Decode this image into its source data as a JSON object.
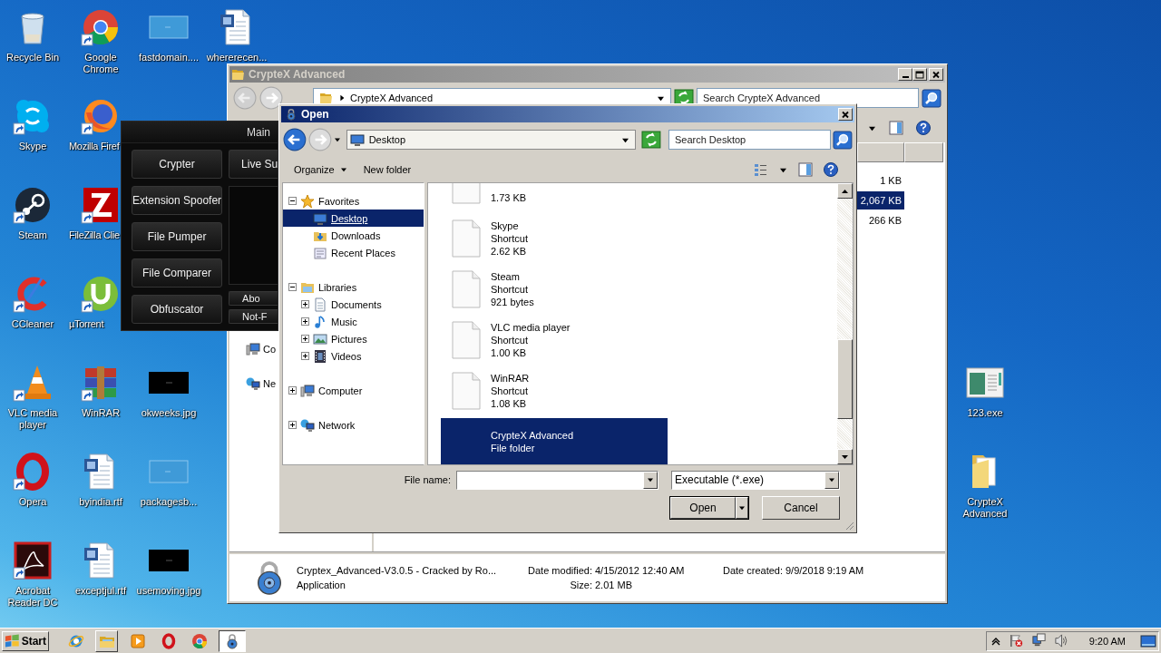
{
  "desktop_icons": [
    {
      "label": "Recycle Bin",
      "kind": "recycle",
      "shortcut": false
    },
    {
      "label": "Google Chrome",
      "kind": "chrome",
      "shortcut": true
    },
    {
      "label": "fastdomain....",
      "kind": "image-light",
      "shortcut": false
    },
    {
      "label": "whererecen...",
      "kind": "word",
      "shortcut": false
    },
    {
      "label": "Skype",
      "kind": "skype",
      "shortcut": true
    },
    {
      "label": "Mozilla Firef",
      "kind": "firefox",
      "shortcut": true
    },
    {
      "label": "Steam",
      "kind": "steam",
      "shortcut": true
    },
    {
      "label": "FileZilla Clie",
      "kind": "filezilla",
      "shortcut": true
    },
    {
      "label": "CCleaner",
      "kind": "ccleaner",
      "shortcut": true
    },
    {
      "label": "µTorrent",
      "kind": "utorrent",
      "shortcut": true
    },
    {
      "label": "VLC media player",
      "kind": "vlc",
      "shortcut": true
    },
    {
      "label": "WinRAR",
      "kind": "winrar",
      "shortcut": true
    },
    {
      "label": "okweeks.jpg",
      "kind": "image-dark",
      "shortcut": false
    },
    {
      "label": "Opera",
      "kind": "opera",
      "shortcut": true
    },
    {
      "label": "byindia.rtf",
      "kind": "word",
      "shortcut": false
    },
    {
      "label": "packagesb...",
      "kind": "image-light",
      "shortcut": false
    },
    {
      "label": "Acrobat Reader DC",
      "kind": "acrobat",
      "shortcut": true
    },
    {
      "label": "exceptjul.rtf",
      "kind": "word",
      "shortcut": false
    },
    {
      "label": "usemoving.jpg",
      "kind": "image-dark",
      "shortcut": false
    },
    {
      "label": "123.exe",
      "kind": "app-window",
      "shortcut": false
    },
    {
      "label": "CrypteX Advanced",
      "kind": "folder",
      "shortcut": false
    }
  ],
  "explorer": {
    "title": "CrypteX Advanced",
    "address": "CrypteX Advanced",
    "search_placeholder": "Search CrypteX Advanced",
    "nav_items": [
      {
        "label": "Co",
        "kind": "computer"
      },
      {
        "label": "Ne",
        "kind": "network"
      }
    ],
    "rows": [
      {
        "size": "1 KB",
        "selected": false
      },
      {
        "size": "2,067 KB",
        "selected": true
      },
      {
        "size": "266 KB",
        "selected": false
      }
    ],
    "details": {
      "name": "Cryptex_Advanced-V3.0.5 - Cracked by Ro...",
      "type": "Application",
      "modified_label": "Date modified:",
      "modified": "4/15/2012 12:40 AM",
      "size_label": "Size:",
      "size": "2.01 MB",
      "created_label": "Date created:",
      "created": "9/9/2018 9:19 AM"
    }
  },
  "crypter": {
    "tab": "Main",
    "left_buttons": [
      "Crypter",
      "Extension Spoofer",
      "File Pumper",
      "File Comparer",
      "Obfuscator"
    ],
    "right_buttons": [
      {
        "label": "Live Su",
        "kind": "large"
      },
      {
        "label": "Abo",
        "kind": "small"
      },
      {
        "label": "Not-F",
        "kind": "small"
      }
    ]
  },
  "open_dialog": {
    "title": "Open",
    "address": "Desktop",
    "search_placeholder": "Search Desktop",
    "toolbar": [
      {
        "label": "Organize",
        "kind": "menu"
      },
      {
        "label": "New folder",
        "kind": "button"
      }
    ],
    "nav": [
      {
        "label": "Favorites",
        "kind": "favorites",
        "expanded": true,
        "selected": false,
        "children": [
          {
            "label": "Desktop",
            "kind": "desktop",
            "selected": true
          },
          {
            "label": "Downloads",
            "kind": "downloads",
            "selected": false
          },
          {
            "label": "Recent Places",
            "kind": "recent",
            "selected": false
          }
        ]
      },
      {
        "label": "Libraries",
        "kind": "libraries",
        "expanded": true,
        "selected": false,
        "children": [
          {
            "label": "Documents",
            "kind": "documents",
            "expanded": false,
            "selected": false
          },
          {
            "label": "Music",
            "kind": "music",
            "expanded": false,
            "selected": false
          },
          {
            "label": "Pictures",
            "kind": "pictures",
            "expanded": false,
            "selected": false
          },
          {
            "label": "Videos",
            "kind": "videos",
            "expanded": false,
            "selected": false
          }
        ]
      },
      {
        "label": "Computer",
        "kind": "computer",
        "expanded": false,
        "selected": false
      },
      {
        "label": "Network",
        "kind": "network",
        "expanded": false,
        "selected": false
      }
    ],
    "files": [
      {
        "size": "1.73 KB",
        "kind": "shortcut",
        "selected": false
      },
      {
        "name": "Skype",
        "type": "Shortcut",
        "size": "2.62 KB",
        "kind": "shortcut",
        "selected": false
      },
      {
        "name": "Steam",
        "type": "Shortcut",
        "size": "921 bytes",
        "kind": "shortcut",
        "selected": false
      },
      {
        "name": "VLC media player",
        "type": "Shortcut",
        "size": "1.00 KB",
        "kind": "shortcut",
        "selected": false
      },
      {
        "name": "WinRAR",
        "type": "Shortcut",
        "size": "1.08 KB",
        "kind": "shortcut",
        "selected": false
      },
      {
        "name": "CrypteX Advanced",
        "type": "File folder",
        "kind": "folder",
        "selected": true
      }
    ],
    "file_name_label": "File name:",
    "file_type": "Executable (*.exe)",
    "open_button": "Open",
    "cancel_button": "Cancel"
  },
  "taskbar": {
    "start": "Start",
    "apps": [
      {
        "kind": "ie",
        "running": false,
        "active": false
      },
      {
        "kind": "folder",
        "running": true,
        "active": false
      },
      {
        "kind": "media",
        "running": false,
        "active": false
      },
      {
        "kind": "opera",
        "running": false,
        "active": false
      },
      {
        "kind": "chrome",
        "running": false,
        "active": false
      },
      {
        "kind": "lock",
        "running": true,
        "active": true
      }
    ],
    "clock": "9:20 AM"
  }
}
